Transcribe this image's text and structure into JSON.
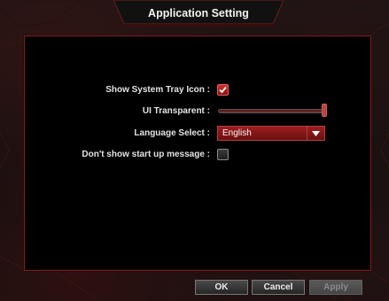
{
  "window": {
    "title": "Application Setting"
  },
  "settings": {
    "tray_icon": {
      "label": "Show System Tray Icon :",
      "checked": true
    },
    "transparency": {
      "label": "UI Transparent :",
      "level_percent": 100
    },
    "language": {
      "label": "Language Select :",
      "value": "English"
    },
    "startup_message": {
      "label": "Don't show start up message :",
      "checked": false
    }
  },
  "buttons": {
    "ok": "OK",
    "cancel": "Cancel",
    "apply": "Apply"
  },
  "colors": {
    "accent": "#9e1e1e",
    "panel": "#000000",
    "frame": "#6e2020"
  },
  "icons": {
    "checkmark": "check-icon",
    "dropdown": "chevron-down-icon"
  }
}
